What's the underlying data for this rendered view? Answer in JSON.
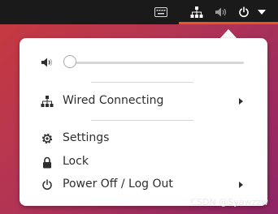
{
  "top_bar": {
    "icons": [
      "keyboard-icon",
      "network-wired-icon",
      "volume-muted-icon",
      "power-icon",
      "dropdown-arrow-icon"
    ],
    "accent": "#e95420"
  },
  "menu": {
    "volume": {
      "icon": "volume-icon",
      "level": 0
    },
    "network": {
      "icon": "network-wired-icon",
      "label": "Wired Connecting",
      "submenu": true
    },
    "settings": {
      "icon": "settings-gear-icon",
      "label": "Settings"
    },
    "lock": {
      "icon": "lock-icon",
      "label": "Lock"
    },
    "power": {
      "icon": "power-icon",
      "label": "Power Off / Log Out",
      "submenu": true
    }
  },
  "watermark": "CSDN @Syawzzw"
}
